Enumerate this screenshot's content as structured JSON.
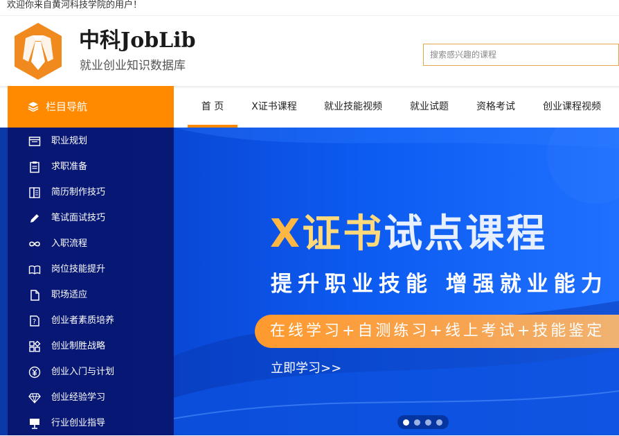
{
  "welcome": {
    "text": "欢迎你来自黄河科技学院的用户！"
  },
  "header": {
    "logo_title": "中科JobLib",
    "logo_subtitle": "就业创业知识数据库",
    "search_placeholder": "搜索感兴趣的课程"
  },
  "sidebar": {
    "title": "栏目导航",
    "items": [
      {
        "label": "职业规划",
        "icon": "browser-window-icon"
      },
      {
        "label": "求职准备",
        "icon": "clipboard-icon"
      },
      {
        "label": "简历制作技巧",
        "icon": "resume-book-icon"
      },
      {
        "label": "笔试面试技巧",
        "icon": "pencil-icon"
      },
      {
        "label": "入职流程",
        "icon": "infinity-icon"
      },
      {
        "label": "岗位技能提升",
        "icon": "open-book-icon"
      },
      {
        "label": "职场适应",
        "icon": "document-icon"
      },
      {
        "label": "创业者素质培养",
        "icon": "question-doc-icon"
      },
      {
        "label": "创业制胜战略",
        "icon": "grid-apps-icon"
      },
      {
        "label": "创业入门与计划",
        "icon": "yen-circle-icon"
      },
      {
        "label": "创业经验学习",
        "icon": "diamond-icon"
      },
      {
        "label": "行业创业指导",
        "icon": "presentation-icon"
      }
    ]
  },
  "nav": {
    "tabs": [
      {
        "label": "首 页",
        "active": true
      },
      {
        "label": "X证书课程",
        "active": false
      },
      {
        "label": "就业技能视频",
        "active": false
      },
      {
        "label": "就业试题",
        "active": false
      },
      {
        "label": "资格考试",
        "active": false
      },
      {
        "label": "创业课程视频",
        "active": false
      }
    ]
  },
  "banner": {
    "title_x": "X",
    "title_zs": "证书",
    "title_rest": "试点课程",
    "subtitle": "提升职业技能 增强就业能力",
    "pill_text": "在线学习+自测练习+线上考试+技能鉴定",
    "cta": "立即学习>>",
    "slide_count": 4,
    "active_slide": 1
  },
  "colors": {
    "accent": "#ff8a00",
    "sidebar_bg": "#08146e",
    "banner_blue": "#0a49d8"
  }
}
